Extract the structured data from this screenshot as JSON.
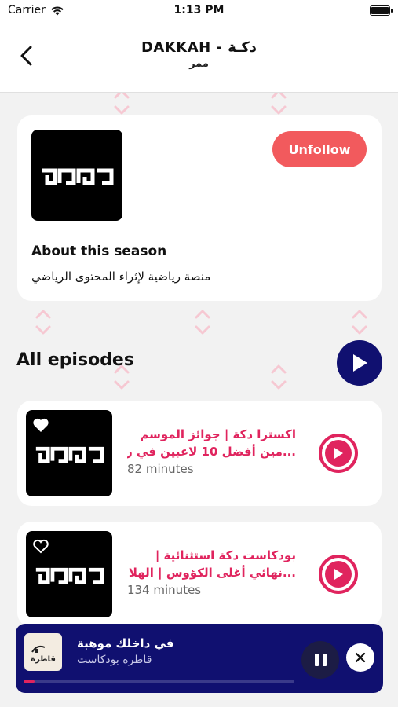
{
  "status_bar": {
    "carrier": "Carrier",
    "time": "1:13 PM"
  },
  "nav": {
    "title": "DAKKAH - دكـة",
    "subtitle": "ممر"
  },
  "season": {
    "follow_button": "Unfollow",
    "about_title": "About this season",
    "about_desc": "منصة رياضية لإثراء المحتوى الرياضي"
  },
  "episodes_section": {
    "title": "All episodes"
  },
  "episodes": [
    {
      "title_line1": "اكسترا دكة | جوائز الموسم",
      "title_line2": "...مين أفضل 10 لاعبين في ر",
      "duration": "82 minutes",
      "favorited": true
    },
    {
      "title_line1": "بودكاست دكة استثنائية |",
      "title_line2": "...نهائي أغلى الكؤوس | الهلا",
      "duration": "134 minutes",
      "favorited": false
    }
  ],
  "mini_player": {
    "title": "في داخلك موهبة",
    "subtitle": "قاطرة بودكاست",
    "thumb_text": "قاطرة",
    "progress": 0.04
  },
  "colors": {
    "accent": "#e0245e",
    "unfollow": "#f25a5d",
    "navy": "#101070"
  },
  "icons": [
    "back-chevron-icon",
    "wifi-icon",
    "battery-icon",
    "play-icon",
    "heart-icon",
    "pause-icon",
    "close-icon"
  ]
}
